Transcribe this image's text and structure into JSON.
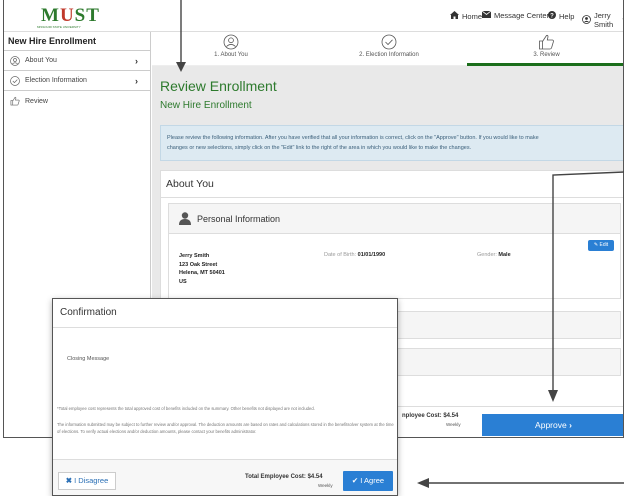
{
  "logo": {
    "text_m": "M",
    "text_u": "U",
    "text_st": "ST",
    "tagline": "MISSOURI STATE UNIVERSITY"
  },
  "nav": {
    "home": "Home",
    "messages": "Message Center",
    "help": "Help",
    "user": "Jerry Smith"
  },
  "sidebar": {
    "title": "New Hire Enrollment",
    "items": [
      {
        "label": "About You",
        "chevron": "›"
      },
      {
        "label": "Election Information",
        "chevron": "›"
      },
      {
        "label": "Review"
      }
    ]
  },
  "steps": [
    {
      "label": "1. About You"
    },
    {
      "label": "2. Election Information"
    },
    {
      "label": "3. Review"
    }
  ],
  "main": {
    "title": "Review Enrollment",
    "subtitle": "New Hire Enrollment",
    "notice_line1": "Please review the following information. After you have verified that all your information is correct, click on the \"Approve\" button. If you would like to make",
    "notice_line2": "changes or new selections, simply click on the \"Edit\" link to the right of the area in which you would like to make the changes.",
    "section_title": "About You",
    "personal_title": "Personal Information",
    "edit_label": "Edit",
    "name": "Jerry Smith",
    "street": "123 Oak Street",
    "city": "Helena, MT 50401",
    "country": "US",
    "dob_label": "Date of Birth:",
    "dob": "01/01/1990",
    "gender_label": "Gender:",
    "gender": "Male"
  },
  "footer": {
    "cost_label": "nployee Cost: $4.54",
    "cost_period": "Weekly",
    "approve_label": "Approve"
  },
  "modal": {
    "title": "Confirmation",
    "message": "Closing Message",
    "disclaimer1": "*Total employee cost represents the total approved cost of benefits included on the summary. Other benefits not displayed are not included.",
    "disclaimer2": "The information submitted may be subject to further review and/or approval. The deduction amounts are based on rates and calculations stored in the benefitsolver system at the time of elections. To verify actual elections and/or deduction amounts, please contact your benefits administrator.",
    "disagree_label": "I Disagree",
    "cost_label": "Total Employee Cost: $4.54",
    "cost_period": "Weekly",
    "agree_label": "I Agree"
  },
  "colors": {
    "green": "#2d7a2d",
    "blue": "#2a7fd4",
    "step_active": "#1b6e1b"
  }
}
